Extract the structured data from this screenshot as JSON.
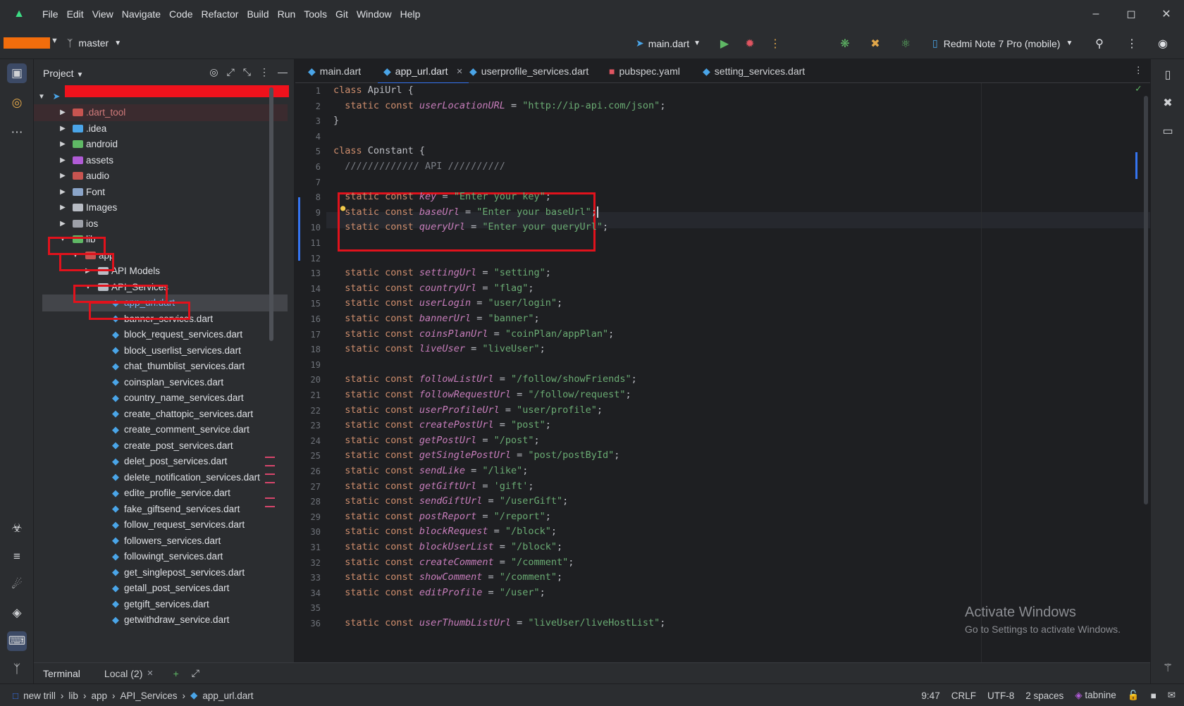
{
  "menu": [
    "File",
    "Edit",
    "View",
    "Navigate",
    "Code",
    "Refactor",
    "Build",
    "Run",
    "Tools",
    "Git",
    "Window",
    "Help"
  ],
  "toolbar": {
    "branch": "master",
    "run_config": "main.dart",
    "device": "Redmi Note 7 Pro (mobile)"
  },
  "project_panel": {
    "title": "Project",
    "tree": [
      {
        "label": ".dart_tool",
        "indent": 0,
        "chevron": "right",
        "icon": "folder",
        "color": "#c75450"
      },
      {
        "label": ".idea",
        "indent": 0,
        "chevron": "right",
        "icon": "folder",
        "color": "#4aa5e8"
      },
      {
        "label": "android",
        "indent": 0,
        "chevron": "right",
        "icon": "folder",
        "color": "#5fb865"
      },
      {
        "label": "assets",
        "indent": 0,
        "chevron": "right",
        "icon": "folder",
        "color": "#b05bd6"
      },
      {
        "label": "audio",
        "indent": 0,
        "chevron": "right",
        "icon": "folder",
        "color": "#c75450"
      },
      {
        "label": "Font",
        "indent": 0,
        "chevron": "right",
        "icon": "folder",
        "color": "#8aa4c8"
      },
      {
        "label": "Images",
        "indent": 0,
        "chevron": "right",
        "icon": "folder",
        "color": "#b8bcc4"
      },
      {
        "label": "ios",
        "indent": 0,
        "chevron": "right",
        "icon": "folder",
        "color": "#9da0a8"
      },
      {
        "label": "lib",
        "indent": 0,
        "chevron": "down",
        "icon": "folder",
        "color": "#5fb865"
      },
      {
        "label": "app",
        "indent": 1,
        "chevron": "down",
        "icon": "folder",
        "color": "#c75450"
      },
      {
        "label": "API Models",
        "indent": 2,
        "chevron": "right",
        "icon": "folder",
        "color": "#b8bcc4"
      },
      {
        "label": "API_Services",
        "indent": 2,
        "chevron": "down",
        "icon": "folder",
        "color": "#b8bcc4"
      },
      {
        "label": "app_url.dart",
        "indent": 3,
        "chevron": "",
        "icon": "dart",
        "color": "#4aa5e8"
      },
      {
        "label": "banner_services.dart",
        "indent": 3,
        "chevron": "",
        "icon": "dart",
        "color": "#4aa5e8"
      },
      {
        "label": "block_request_services.dart",
        "indent": 3,
        "chevron": "",
        "icon": "dart",
        "color": "#4aa5e8"
      },
      {
        "label": "block_userlist_services.dart",
        "indent": 3,
        "chevron": "",
        "icon": "dart",
        "color": "#4aa5e8"
      },
      {
        "label": "chat_thumblist_services.dart",
        "indent": 3,
        "chevron": "",
        "icon": "dart",
        "color": "#4aa5e8"
      },
      {
        "label": "coinsplan_services.dart",
        "indent": 3,
        "chevron": "",
        "icon": "dart",
        "color": "#4aa5e8"
      },
      {
        "label": "country_name_services.dart",
        "indent": 3,
        "chevron": "",
        "icon": "dart",
        "color": "#4aa5e8"
      },
      {
        "label": "create_chattopic_services.dart",
        "indent": 3,
        "chevron": "",
        "icon": "dart",
        "color": "#4aa5e8"
      },
      {
        "label": "create_comment_service.dart",
        "indent": 3,
        "chevron": "",
        "icon": "dart",
        "color": "#4aa5e8"
      },
      {
        "label": "create_post_services.dart",
        "indent": 3,
        "chevron": "",
        "icon": "dart",
        "color": "#4aa5e8"
      },
      {
        "label": "delet_post_services.dart",
        "indent": 3,
        "chevron": "",
        "icon": "dart",
        "color": "#4aa5e8"
      },
      {
        "label": "delete_notification_services.dart",
        "indent": 3,
        "chevron": "",
        "icon": "dart",
        "color": "#4aa5e8"
      },
      {
        "label": "edite_profile_service.dart",
        "indent": 3,
        "chevron": "",
        "icon": "dart",
        "color": "#4aa5e8"
      },
      {
        "label": "fake_giftsend_services.dart",
        "indent": 3,
        "chevron": "",
        "icon": "dart",
        "color": "#4aa5e8"
      },
      {
        "label": "follow_request_services.dart",
        "indent": 3,
        "chevron": "",
        "icon": "dart",
        "color": "#4aa5e8"
      },
      {
        "label": "followers_services.dart",
        "indent": 3,
        "chevron": "",
        "icon": "dart",
        "color": "#4aa5e8"
      },
      {
        "label": "followingt_services.dart",
        "indent": 3,
        "chevron": "",
        "icon": "dart",
        "color": "#4aa5e8"
      },
      {
        "label": "get_singlepost_services.dart",
        "indent": 3,
        "chevron": "",
        "icon": "dart",
        "color": "#4aa5e8"
      },
      {
        "label": "getall_post_services.dart",
        "indent": 3,
        "chevron": "",
        "icon": "dart",
        "color": "#4aa5e8"
      },
      {
        "label": "getgift_services.dart",
        "indent": 3,
        "chevron": "",
        "icon": "dart",
        "color": "#4aa5e8"
      },
      {
        "label": "getwithdraw_service.dart",
        "indent": 3,
        "chevron": "",
        "icon": "dart",
        "color": "#4aa5e8"
      }
    ]
  },
  "tabs": [
    {
      "label": "main.dart",
      "icon": "dart-icon",
      "active": false
    },
    {
      "label": "app_url.dart",
      "icon": "dart-icon",
      "active": true
    },
    {
      "label": "userprofile_services.dart",
      "icon": "dart-icon",
      "active": false
    },
    {
      "label": "pubspec.yaml",
      "icon": "lock-icon",
      "active": false
    },
    {
      "label": "setting_services.dart",
      "icon": "dart-icon",
      "active": false
    }
  ],
  "code": [
    {
      "n": "1",
      "parts": [
        [
          "kw",
          "class "
        ],
        [
          "cls",
          "ApiUrl {"
        ]
      ]
    },
    {
      "n": "2",
      "parts": [
        [
          "kw",
          "  static const "
        ],
        [
          "id",
          "userLocationURL"
        ],
        [
          "cls",
          " = "
        ],
        [
          "str",
          "\"http://ip-api.com/json\""
        ],
        [
          "cls",
          ";"
        ]
      ]
    },
    {
      "n": "3",
      "parts": [
        [
          "cls",
          "}"
        ]
      ]
    },
    {
      "n": "4",
      "parts": []
    },
    {
      "n": "5",
      "parts": [
        [
          "kw",
          "class "
        ],
        [
          "cls",
          "Constant {"
        ]
      ]
    },
    {
      "n": "6",
      "parts": [
        [
          "cmt",
          "  ///////////// API //////////"
        ]
      ]
    },
    {
      "n": "7",
      "parts": []
    },
    {
      "n": "8",
      "parts": [
        [
          "kw",
          "  static const "
        ],
        [
          "id",
          "key"
        ],
        [
          "cls",
          " = "
        ],
        [
          "str",
          "\"Enter your key\""
        ],
        [
          "cls",
          ";"
        ]
      ]
    },
    {
      "n": "9",
      "parts": [
        [
          "kw",
          "  static const "
        ],
        [
          "id",
          "baseUrl"
        ],
        [
          "cls",
          " = "
        ],
        [
          "str",
          "\"Enter your baseUrl\""
        ],
        [
          "cls",
          ";"
        ]
      ]
    },
    {
      "n": "10",
      "parts": [
        [
          "kw",
          "  static const "
        ],
        [
          "id",
          "queryUrl"
        ],
        [
          "cls",
          " = "
        ],
        [
          "str",
          "\"Enter your queryUrl\""
        ],
        [
          "cls",
          ";"
        ]
      ]
    },
    {
      "n": "11",
      "parts": []
    },
    {
      "n": "12",
      "parts": []
    },
    {
      "n": "13",
      "parts": [
        [
          "kw",
          "  static const "
        ],
        [
          "id",
          "settingUrl"
        ],
        [
          "cls",
          " = "
        ],
        [
          "str",
          "\"setting\""
        ],
        [
          "cls",
          ";"
        ]
      ]
    },
    {
      "n": "14",
      "parts": [
        [
          "kw",
          "  static const "
        ],
        [
          "id",
          "countryUrl"
        ],
        [
          "cls",
          " = "
        ],
        [
          "str",
          "\"flag\""
        ],
        [
          "cls",
          ";"
        ]
      ]
    },
    {
      "n": "15",
      "parts": [
        [
          "kw",
          "  static const "
        ],
        [
          "id",
          "userLogin"
        ],
        [
          "cls",
          " = "
        ],
        [
          "str",
          "\"user/login\""
        ],
        [
          "cls",
          ";"
        ]
      ]
    },
    {
      "n": "16",
      "parts": [
        [
          "kw",
          "  static const "
        ],
        [
          "id",
          "bannerUrl"
        ],
        [
          "cls",
          " = "
        ],
        [
          "str",
          "\"banner\""
        ],
        [
          "cls",
          ";"
        ]
      ]
    },
    {
      "n": "17",
      "parts": [
        [
          "kw",
          "  static const "
        ],
        [
          "id",
          "coinsPlanUrl"
        ],
        [
          "cls",
          " = "
        ],
        [
          "str",
          "\"coinPlan/appPlan\""
        ],
        [
          "cls",
          ";"
        ]
      ]
    },
    {
      "n": "18",
      "parts": [
        [
          "kw",
          "  static const "
        ],
        [
          "id",
          "liveUser"
        ],
        [
          "cls",
          " = "
        ],
        [
          "str",
          "\"liveUser\""
        ],
        [
          "cls",
          ";"
        ]
      ]
    },
    {
      "n": "19",
      "parts": []
    },
    {
      "n": "20",
      "parts": [
        [
          "kw",
          "  static const "
        ],
        [
          "id",
          "followListUrl"
        ],
        [
          "cls",
          " = "
        ],
        [
          "str",
          "\"/follow/showFriends\""
        ],
        [
          "cls",
          ";"
        ]
      ]
    },
    {
      "n": "21",
      "parts": [
        [
          "kw",
          "  static const "
        ],
        [
          "id",
          "followRequestUrl"
        ],
        [
          "cls",
          " = "
        ],
        [
          "str",
          "\"/follow/request\""
        ],
        [
          "cls",
          ";"
        ]
      ]
    },
    {
      "n": "22",
      "parts": [
        [
          "kw",
          "  static const "
        ],
        [
          "id",
          "userProfileUrl"
        ],
        [
          "cls",
          " = "
        ],
        [
          "str",
          "\"user/profile\""
        ],
        [
          "cls",
          ";"
        ]
      ]
    },
    {
      "n": "23",
      "parts": [
        [
          "kw",
          "  static const "
        ],
        [
          "id",
          "createPostUrl"
        ],
        [
          "cls",
          " = "
        ],
        [
          "str",
          "\"post\""
        ],
        [
          "cls",
          ";"
        ]
      ]
    },
    {
      "n": "24",
      "parts": [
        [
          "kw",
          "  static const "
        ],
        [
          "id",
          "getPostUrl"
        ],
        [
          "cls",
          " = "
        ],
        [
          "str",
          "\"/post\""
        ],
        [
          "cls",
          ";"
        ]
      ]
    },
    {
      "n": "25",
      "parts": [
        [
          "kw",
          "  static const "
        ],
        [
          "id",
          "getSinglePostUrl"
        ],
        [
          "cls",
          " = "
        ],
        [
          "str",
          "\"post/postById\""
        ],
        [
          "cls",
          ";"
        ]
      ]
    },
    {
      "n": "26",
      "parts": [
        [
          "kw",
          "  static const "
        ],
        [
          "id",
          "sendLike"
        ],
        [
          "cls",
          " = "
        ],
        [
          "str",
          "\"/like\""
        ],
        [
          "cls",
          ";"
        ]
      ]
    },
    {
      "n": "27",
      "parts": [
        [
          "kw",
          "  static const "
        ],
        [
          "id",
          "getGiftUrl"
        ],
        [
          "cls",
          " = "
        ],
        [
          "str",
          "'gift'"
        ],
        [
          "cls",
          ";"
        ]
      ]
    },
    {
      "n": "28",
      "parts": [
        [
          "kw",
          "  static const "
        ],
        [
          "id",
          "sendGiftUrl"
        ],
        [
          "cls",
          " = "
        ],
        [
          "str",
          "\"/userGift\""
        ],
        [
          "cls",
          ";"
        ]
      ]
    },
    {
      "n": "29",
      "parts": [
        [
          "kw",
          "  static const "
        ],
        [
          "id",
          "postReport"
        ],
        [
          "cls",
          " = "
        ],
        [
          "str",
          "\"/report\""
        ],
        [
          "cls",
          ";"
        ]
      ]
    },
    {
      "n": "30",
      "parts": [
        [
          "kw",
          "  static const "
        ],
        [
          "id",
          "blockRequest"
        ],
        [
          "cls",
          " = "
        ],
        [
          "str",
          "\"/block\""
        ],
        [
          "cls",
          ";"
        ]
      ]
    },
    {
      "n": "31",
      "parts": [
        [
          "kw",
          "  static const "
        ],
        [
          "id",
          "blockUserList"
        ],
        [
          "cls",
          " = "
        ],
        [
          "str",
          "\"/block\""
        ],
        [
          "cls",
          ";"
        ]
      ]
    },
    {
      "n": "32",
      "parts": [
        [
          "kw",
          "  static const "
        ],
        [
          "id",
          "createComment"
        ],
        [
          "cls",
          " = "
        ],
        [
          "str",
          "\"/comment\""
        ],
        [
          "cls",
          ";"
        ]
      ]
    },
    {
      "n": "33",
      "parts": [
        [
          "kw",
          "  static const "
        ],
        [
          "id",
          "showComment"
        ],
        [
          "cls",
          " = "
        ],
        [
          "str",
          "\"/comment\""
        ],
        [
          "cls",
          ";"
        ]
      ]
    },
    {
      "n": "34",
      "parts": [
        [
          "kw",
          "  static const "
        ],
        [
          "id",
          "editProfile"
        ],
        [
          "cls",
          " = "
        ],
        [
          "str",
          "\"/user\""
        ],
        [
          "cls",
          ";"
        ]
      ]
    },
    {
      "n": "35",
      "parts": []
    },
    {
      "n": "36",
      "parts": [
        [
          "kw",
          "  static const "
        ],
        [
          "id",
          "userThumbListUrl"
        ],
        [
          "cls",
          " = "
        ],
        [
          "str",
          "\"liveUser/liveHostList\""
        ],
        [
          "cls",
          ";"
        ]
      ]
    }
  ],
  "watermark": {
    "line1": "Activate Windows",
    "line2": "Go to Settings to activate Windows."
  },
  "terminal": {
    "title": "Terminal",
    "tab": "Local (2)"
  },
  "statusbar": {
    "crumbs": [
      "new trill",
      "lib",
      "app",
      "API_Services",
      "app_url.dart"
    ],
    "position": "9:47",
    "line_ending": "CRLF",
    "encoding": "UTF-8",
    "indent": "2 spaces",
    "plugin": "tabnine"
  },
  "colors": {
    "accent": "#3574f0",
    "annotation_red": "#e1121c",
    "keyword": "#cf8e6d",
    "identifier": "#c77dbb",
    "string": "#6aab73"
  }
}
